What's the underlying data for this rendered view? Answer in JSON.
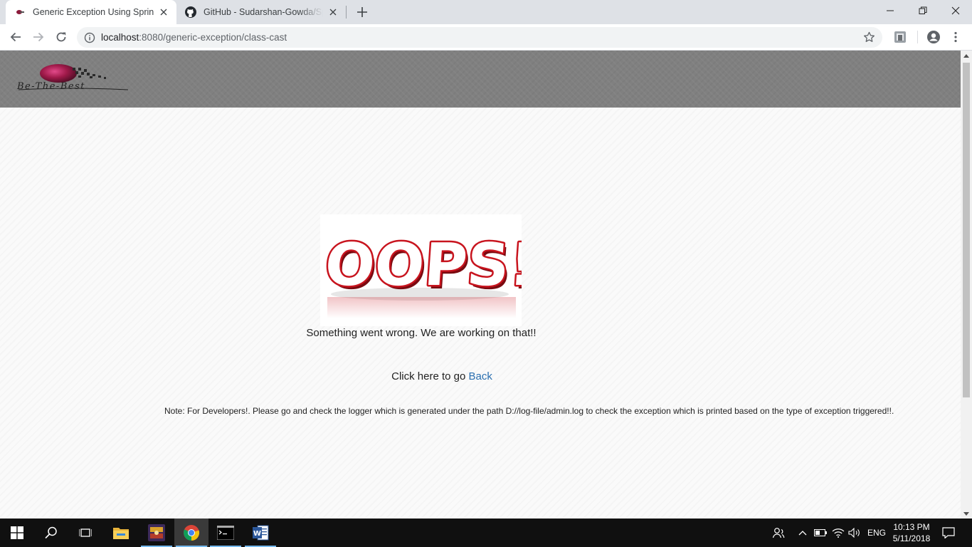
{
  "browser": {
    "tabs": [
      {
        "title": "Generic Exception Using Spring",
        "active": true,
        "icon": "site-logo-icon"
      },
      {
        "title": "GitHub - Sudarshan-Gowda/Spring",
        "active": false,
        "icon": "github-icon"
      }
    ],
    "address": {
      "host": "localhost",
      "rest": ":8080/generic-exception/class-cast"
    }
  },
  "page": {
    "logo_text": "Be-The-Best",
    "oops_text": "OOPS!",
    "message": "Something went wrong. We are working on that!!",
    "back_prefix": "Click here to go ",
    "back_link": "Back",
    "note": "Note: For Developers!. Please go and check the logger which is generated under the path D://log-file/admin.log to check the exception which is printed based on the type of exception triggered!!."
  },
  "taskbar": {
    "lang": "ENG",
    "time": "10:13 PM",
    "date": "5/11/2018",
    "apps": [
      "file-explorer-icon",
      "game-app-icon",
      "chrome-icon",
      "command-prompt-icon",
      "word-icon"
    ]
  },
  "colors": {
    "header_bg": "#808080",
    "link": "#2a6fb0",
    "oops_red": "#c8141e",
    "taskbar": "#101010"
  }
}
